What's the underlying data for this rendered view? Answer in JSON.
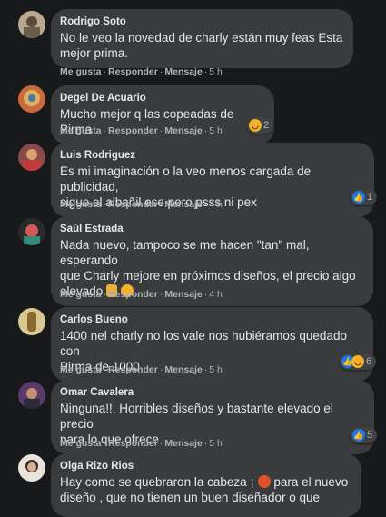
{
  "actions": {
    "like": "Me gusta",
    "reply": "Responder",
    "message": "Mensaje",
    "dot": "·"
  },
  "comments": [
    {
      "author": "Rodrigo Soto",
      "lines": [
        "No le veo la novedad de charly están muy feas Esta",
        "mejor prima."
      ],
      "time": "5 h"
    },
    {
      "author": "Degel De Acuario",
      "lines": [
        "Mucho mejor q las copeadas de Pirma"
      ],
      "time": "5 h",
      "reaction_count": "2",
      "reaction_types": [
        "haha"
      ]
    },
    {
      "author": "Luis Rodriguez",
      "lines": [
        "Es mi imaginación o la veo menos cargada de publicidad,",
        "sigue el albañil ese pero psss ni pex"
      ],
      "time": "4 h",
      "reaction_count": "1",
      "reaction_types": [
        "like"
      ]
    },
    {
      "author": "Saúl Estrada",
      "lines": [
        "Nada nuevo, tampoco se me hacen \"tan\" mal, esperando",
        "que Charly mejore en próximos diseños, el precio algo",
        "elevado"
      ],
      "time": "4 h"
    },
    {
      "author": "Carlos Bueno",
      "lines": [
        "1400 nel charly no los vale nos hubiéramos quedado con",
        "Pirma de 1000"
      ],
      "time": "5 h",
      "reaction_count": "6",
      "reaction_types": [
        "like",
        "haha"
      ]
    },
    {
      "author": "Omar Cavalera",
      "lines": [
        "Ninguna!!. Horribles diseños y bastante elevado el precio",
        "para lo que ofrece"
      ],
      "time": "5 h",
      "reaction_count": "5",
      "reaction_types": [
        "like"
      ]
    },
    {
      "author": "Olga Rizo Rios",
      "lines": [
        "Hay como se quebraron la cabeza ¡",
        "diseño , que no tienen un buen diseñador o que"
      ],
      "line1_suffix": " para el nuevo",
      "time": ""
    }
  ]
}
